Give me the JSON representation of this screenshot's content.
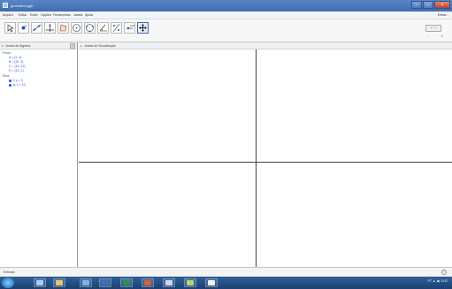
{
  "window": {
    "title": "geometria.ggb",
    "buttons": {
      "minimize": "–",
      "maximize": "□",
      "close": "×"
    }
  },
  "menubar": {
    "items": [
      "Arquivo",
      "Editar",
      "Exibir",
      "Opções",
      "Ferramentas",
      "Janela",
      "Ajuda"
    ],
    "login": "Entrar..."
  },
  "toolbar": {
    "tools": [
      {
        "icon": "move-arrow-icon"
      },
      {
        "icon": "point-icon"
      },
      {
        "icon": "line-icon"
      },
      {
        "icon": "perpendicular-line-icon"
      },
      {
        "icon": "polygon-icon"
      },
      {
        "icon": "circle-icon"
      },
      {
        "icon": "circle-through-points-icon"
      },
      {
        "icon": "angle-icon"
      },
      {
        "icon": "reflect-icon"
      },
      {
        "icon": "slider-icon"
      },
      {
        "icon": "move-graphics-icon",
        "active": true
      }
    ],
    "undo_label": "↶ ↷"
  },
  "algebra": {
    "header": "Janela de Álgebra",
    "categories": [
      {
        "name": "Ponto",
        "items": [
          {
            "text": "A = (1, 4)"
          },
          {
            "text": "B = (20, 3)"
          },
          {
            "text": "C = (10, 12)"
          },
          {
            "text": "D = (10, 1)"
          }
        ]
      },
      {
        "name": "Reta",
        "items": [
          {
            "text": "f: y = 3"
          },
          {
            "text": "g: x = 10"
          }
        ]
      }
    ]
  },
  "graphics": {
    "header": "Janela de Visualização"
  },
  "inputbar": {
    "label": "Entrada:",
    "help": "?"
  },
  "taskbar": {
    "tray_text": "PT  ▲  ◀)  13:57"
  },
  "colors": {
    "titlebar": "#3f6cb0",
    "object_blue": "#2a4de0",
    "axis": "#444444",
    "taskbar": "#1d3f70"
  }
}
